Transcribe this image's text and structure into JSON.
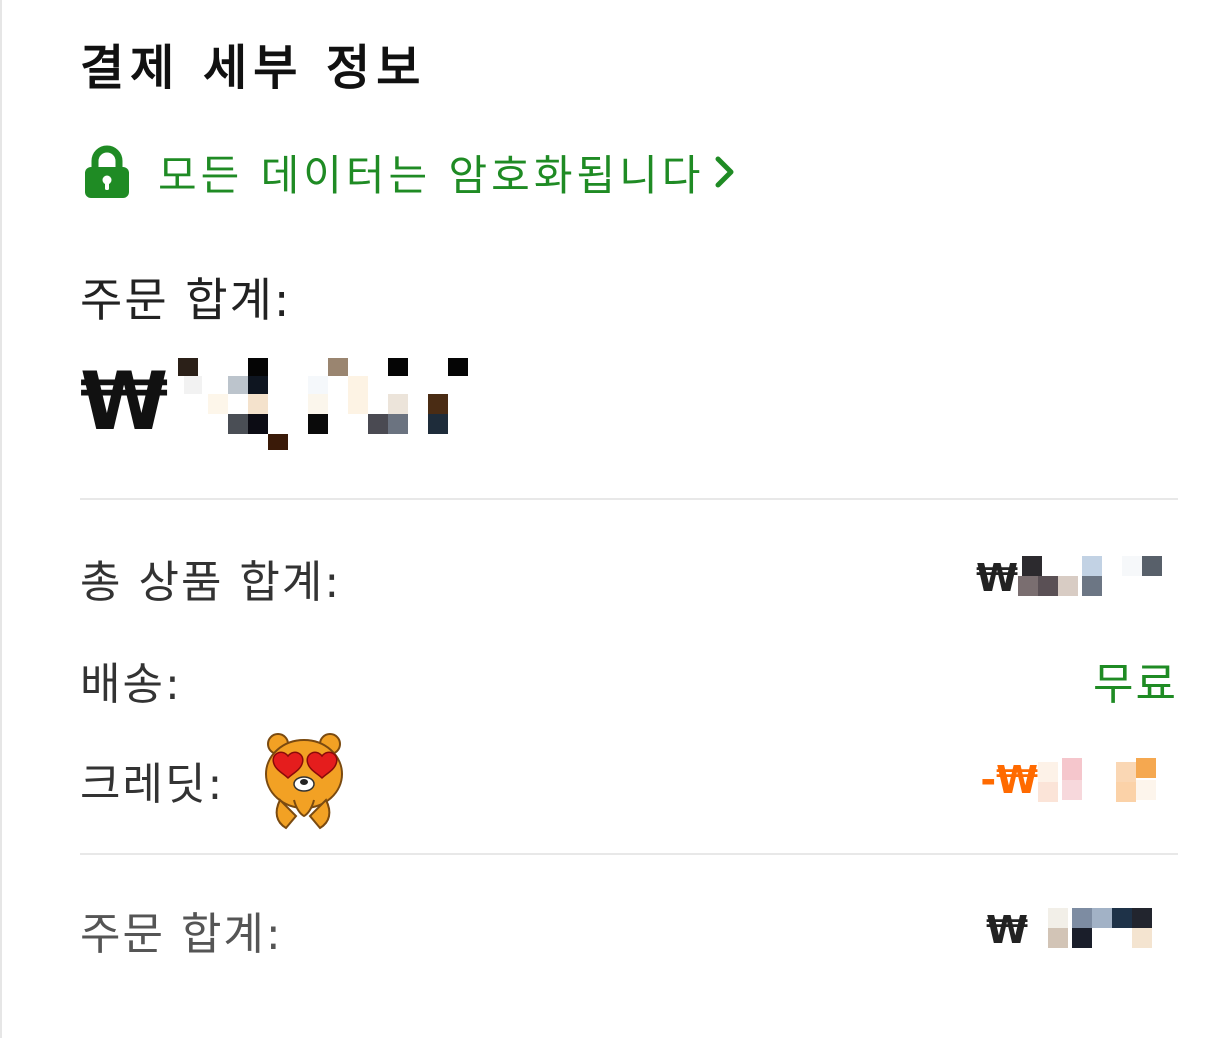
{
  "title": "결제 세부 정보",
  "secure": {
    "text": "모든 데이터는 암호화됩니다",
    "accent": "#1f8b24"
  },
  "order_total": {
    "label": "주문 합계:",
    "currency": "₩"
  },
  "summary": {
    "items_total": {
      "label": "총 상품 합계:",
      "currency": "₩"
    },
    "shipping": {
      "label": "배송:",
      "value": "무료"
    },
    "credit": {
      "label": "크레딧:",
      "prefix": "-₩",
      "color": "#ff6a00"
    }
  },
  "grand_total": {
    "label": "주문 합계:",
    "currency": "₩"
  },
  "icons": {
    "lock": "lock-icon",
    "chevron": "chevron-right-icon",
    "sticker": "bear-sticker-icon"
  }
}
